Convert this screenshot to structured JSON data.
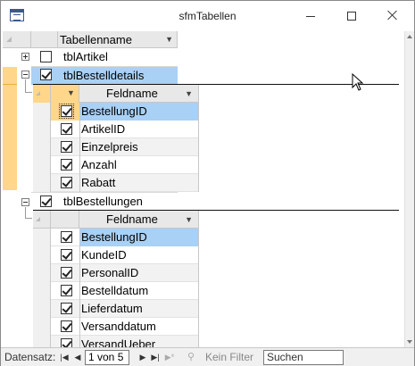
{
  "window": {
    "title": "sfmTabellen",
    "icon": "form-icon",
    "controls": {
      "minimize": "minimize-icon",
      "maximize": "maximize-icon",
      "close": "close-icon"
    }
  },
  "grid": {
    "header": {
      "column": "Tabellenname"
    },
    "rows": [
      {
        "name": "tblArtikel",
        "checked": false,
        "expanded": false
      },
      {
        "name": "tblBestelldetails",
        "checked": true,
        "expanded": true,
        "selected": true
      },
      {
        "name": "tblBestellungen",
        "checked": true,
        "expanded": true
      }
    ],
    "sub1": {
      "header": "Feldname",
      "rows": [
        {
          "name": "BestellungID",
          "checked": true,
          "selected": true,
          "focus": true
        },
        {
          "name": "ArtikelID",
          "checked": true
        },
        {
          "name": "Einzelpreis",
          "checked": true
        },
        {
          "name": "Anzahl",
          "checked": true
        },
        {
          "name": "Rabatt",
          "checked": true
        }
      ]
    },
    "sub2": {
      "header": "Feldname",
      "rows": [
        {
          "name": "BestellungID",
          "checked": true,
          "selected": true
        },
        {
          "name": "KundeID",
          "checked": true
        },
        {
          "name": "PersonalID",
          "checked": true
        },
        {
          "name": "Bestelldatum",
          "checked": true
        },
        {
          "name": "Lieferdatum",
          "checked": true
        },
        {
          "name": "Versanddatum",
          "checked": true
        },
        {
          "name": "VersandUeber",
          "checked": true
        }
      ]
    }
  },
  "navbar": {
    "label": "Datensatz:",
    "position": "1 von 5",
    "filter": "Kein Filter",
    "search": "Suchen"
  },
  "colors": {
    "selection": "#a9d0f5",
    "record_selector": "#ffd68a"
  }
}
